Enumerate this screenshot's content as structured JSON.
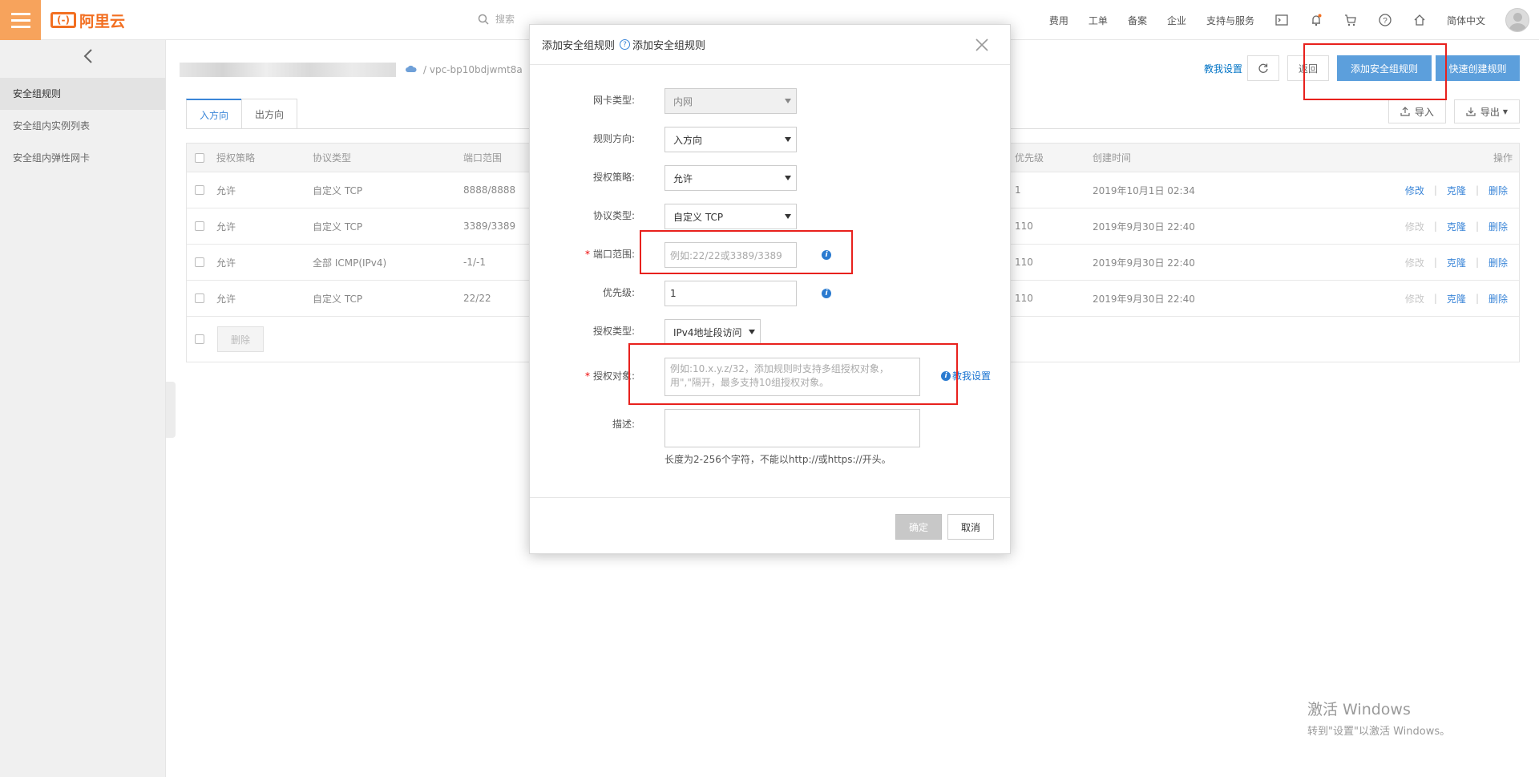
{
  "topbar": {
    "logo_text": "阿里云",
    "logo_mark": "(-)",
    "search_placeholder": "搜索",
    "nav_items": [
      "费用",
      "工单",
      "备案",
      "企业",
      "支持与服务"
    ],
    "language": "简体中文"
  },
  "sidebar": {
    "items": [
      {
        "label": "安全组规则",
        "active": true
      },
      {
        "label": "安全组内实例列表",
        "active": false
      },
      {
        "label": "安全组内弹性网卡",
        "active": false
      }
    ]
  },
  "breadcrumb": {
    "vpc": "/ vpc-bp10bdjwmt8a"
  },
  "actions": {
    "teach": "教我设置",
    "back": "返回",
    "add_rule": "添加安全组规则",
    "quick_create": "快速创建规则",
    "import": "导入",
    "export": "导出"
  },
  "tabs": [
    {
      "label": "入方向",
      "active": true
    },
    {
      "label": "出方向",
      "active": false
    }
  ],
  "table": {
    "headers": {
      "policy": "授权策略",
      "protocol": "协议类型",
      "port": "端口范围",
      "priority": "优先级",
      "created": "创建时间",
      "actions": "操作"
    },
    "rows": [
      {
        "policy": "允许",
        "protocol": "自定义 TCP",
        "port": "8888/8888",
        "priority": "1",
        "created": "2019年10月1日 02:34",
        "edit": "修改",
        "clone": "克隆",
        "delete": "删除",
        "edit_enabled": true
      },
      {
        "policy": "允许",
        "protocol": "自定义 TCP",
        "port": "3389/3389",
        "priority": "110",
        "created": "2019年9月30日 22:40",
        "edit": "修改",
        "clone": "克隆",
        "delete": "删除",
        "edit_enabled": false
      },
      {
        "policy": "允许",
        "protocol": "全部 ICMP(IPv4)",
        "port": "-1/-1",
        "priority": "110",
        "created": "2019年9月30日 22:40",
        "edit": "修改",
        "clone": "克隆",
        "delete": "删除",
        "edit_enabled": false
      },
      {
        "policy": "允许",
        "protocol": "自定义 TCP",
        "port": "22/22",
        "priority": "110",
        "created": "2019年9月30日 22:40",
        "edit": "修改",
        "clone": "克隆",
        "delete": "删除",
        "edit_enabled": false
      }
    ],
    "bulk_delete": "删除"
  },
  "modal": {
    "title": "添加安全组规则",
    "help_label": "添加安全组规则",
    "nic_type_label": "网卡类型:",
    "nic_type_value": "内网",
    "direction_label": "规则方向:",
    "direction_value": "入方向",
    "policy_label": "授权策略:",
    "policy_value": "允许",
    "protocol_label": "协议类型:",
    "protocol_value": "自定义 TCP",
    "port_label": "端口范围:",
    "port_placeholder": "例如:22/22或3389/3389",
    "priority_label": "优先级:",
    "priority_value": "1",
    "auth_type_label": "授权类型:",
    "auth_type_value": "IPv4地址段访问",
    "auth_object_label": "授权对象:",
    "auth_object_placeholder": "例如:10.x.y.z/32，添加规则时支持多组授权对象，用\",\"隔开，最多支持10组授权对象。",
    "teach_link": "教我设置",
    "desc_label": "描述:",
    "desc_hint": "长度为2-256个字符，不能以http://或https://开头。",
    "confirm": "确定",
    "cancel": "取消"
  },
  "watermark": {
    "line1": "激活 Windows",
    "line2": "转到\"设置\"以激活 Windows。"
  }
}
